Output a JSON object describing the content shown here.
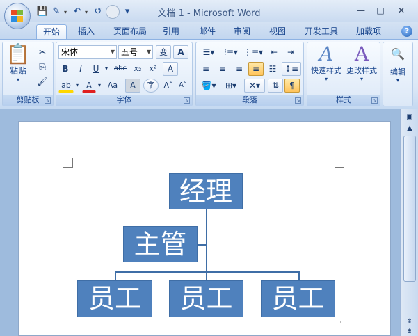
{
  "window": {
    "title": "文档 1 - Microsoft Word",
    "controls": [
      "—",
      "□",
      "✕"
    ]
  },
  "quick_access": {
    "icons": [
      "save-icon",
      "repeat-typing-icon",
      "undo-icon",
      "redo-icon",
      "customize-icon"
    ],
    "glyphs": [
      "💾",
      "✎",
      "↶",
      "↺",
      "▾"
    ]
  },
  "tabs": [
    {
      "label": "开始",
      "active": true
    },
    {
      "label": "插入"
    },
    {
      "label": "页面布局"
    },
    {
      "label": "引用"
    },
    {
      "label": "邮件"
    },
    {
      "label": "审阅"
    },
    {
      "label": "视图"
    },
    {
      "label": "开发工具"
    },
    {
      "label": "加载项"
    }
  ],
  "help_glyph": "?",
  "ribbon": {
    "clipboard": {
      "label": "剪贴板",
      "paste_label": "粘贴"
    },
    "font": {
      "label": "字体",
      "font_name": "宋体",
      "font_size": "五号",
      "btn_wen": "变",
      "btn_a": "A",
      "bold": "B",
      "italic": "I",
      "underline": "U",
      "strike": "abc",
      "subscript": "x₂",
      "superscript": "x²",
      "clear": "A",
      "highlight": "ab",
      "font_color": "A",
      "change_case": "Aa",
      "char_shading": "A",
      "enclose": "字",
      "grow": "A˄",
      "shrink": "A˅"
    },
    "paragraph": {
      "label": "段落"
    },
    "styles": {
      "label": "样式",
      "quick_styles": "快速样式",
      "change_styles": "更改样式"
    },
    "editing": {
      "label": "编辑"
    },
    "colors": {
      "accent": "#15428b",
      "highlight_yellow": "#ffd700",
      "font_red": "#e02020"
    }
  },
  "document": {
    "org_chart": {
      "manager": "经理",
      "supervisor": "主管",
      "staff": [
        "员工",
        "员工",
        "员工"
      ],
      "box_color": "#4f81bd",
      "line_color": "#3f6ea6"
    }
  }
}
